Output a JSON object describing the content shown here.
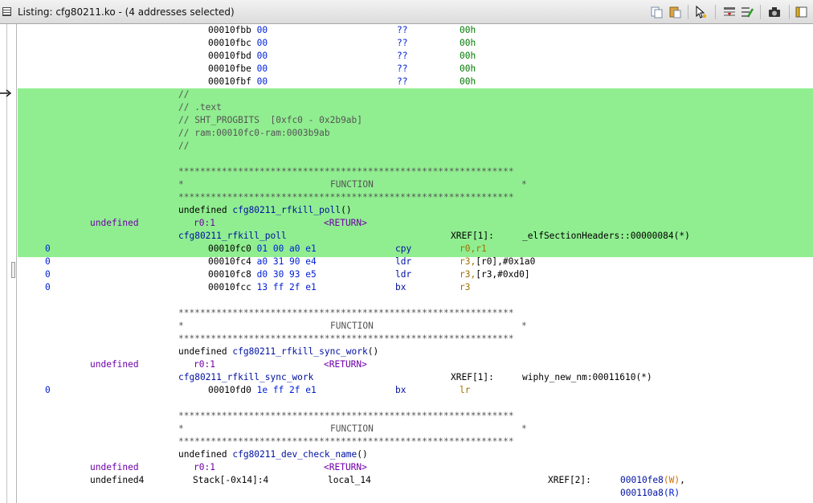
{
  "window": {
    "title": "Listing:  cfg80211.ko - (4 addresses selected)"
  },
  "toolbar": {
    "icons": [
      "copy-icon",
      "paste-icon",
      "cursor-select-icon",
      "field-layout-icon",
      "edit-fields-icon",
      "snapshot-icon",
      "window-menu-icon"
    ]
  },
  "colors": {
    "selection": "#90ee90",
    "bytes": "#0020d8",
    "comment": "#555555",
    "label": "#007a00",
    "function": "#0010a0",
    "register": "#a07000"
  },
  "data_rows": [
    {
      "addr": "00010fbb",
      "bytes": "00",
      "mnemonic": "??",
      "operand": "00h"
    },
    {
      "addr": "00010fbc",
      "bytes": "00",
      "mnemonic": "??",
      "operand": "00h"
    },
    {
      "addr": "00010fbd",
      "bytes": "00",
      "mnemonic": "??",
      "operand": "00h"
    },
    {
      "addr": "00010fbe",
      "bytes": "00",
      "mnemonic": "??",
      "operand": "00h"
    },
    {
      "addr": "00010fbf",
      "bytes": "00",
      "mnemonic": "??",
      "operand": "00h"
    }
  ],
  "section": {
    "c1": "//",
    "c2": "// .text",
    "c3": "// SHT_PROGBITS  [0xfc0 - 0x2b9ab]",
    "c4": "// ram:00010fc0-ram:0003b9ab",
    "c5": "//"
  },
  "banner": {
    "stars": "**************************************************************",
    "star": "*",
    "label": "FUNCTION"
  },
  "functions": [
    {
      "sig_prefix": "undefined ",
      "name": "cfg80211_rfkill_poll",
      "sig_suffix": "()",
      "ret_type": "undefined",
      "ret_reg": "r0:1",
      "ret_tag": "<RETURN>",
      "label": "cfg80211_rfkill_poll",
      "xref": "XREF[1]:",
      "xref_target": "_elfSectionHeaders::00000084(*)",
      "instructions": [
        {
          "depth": "0",
          "addr": "00010fc0",
          "bytes": "01 00 a0 e1",
          "mnemonic": "cpy",
          "operand_a": "r0,r1",
          "operand_b": ""
        },
        {
          "depth": "0",
          "addr": "00010fc4",
          "bytes": "a0 31 90 e4",
          "mnemonic": "ldr",
          "operand_a": "r3,",
          "operand_b": "[r0],#0x1a0"
        },
        {
          "depth": "0",
          "addr": "00010fc8",
          "bytes": "d0 30 93 e5",
          "mnemonic": "ldr",
          "operand_a": "r3,",
          "operand_b": "[r3,#0xd0]"
        },
        {
          "depth": "0",
          "addr": "00010fcc",
          "bytes": "13 ff 2f e1",
          "mnemonic": "bx",
          "operand_a": "r3",
          "operand_b": ""
        }
      ]
    },
    {
      "sig_prefix": "undefined ",
      "name": "cfg80211_rfkill_sync_work",
      "sig_suffix": "()",
      "ret_type": "undefined",
      "ret_reg": "r0:1",
      "ret_tag": "<RETURN>",
      "label": "cfg80211_rfkill_sync_work",
      "xref": "XREF[1]:",
      "xref_target": "wiphy_new_nm:00011610(*)",
      "instructions": [
        {
          "depth": "0",
          "addr": "00010fd0",
          "bytes": "1e ff 2f e1",
          "mnemonic": "bx",
          "operand_a": "lr",
          "operand_b": ""
        }
      ]
    },
    {
      "sig_prefix": "undefined ",
      "name": "cfg80211_dev_check_name",
      "sig_suffix": "()",
      "ret_type": "undefined",
      "ret_reg": "r0:1",
      "ret_tag": "<RETURN>",
      "param_type": "undefined4",
      "param_storage": "Stack[-0x14]:4",
      "param_name": "local_14",
      "xref": "XREF[2]:",
      "xref_1": "00010fe8",
      "xref_1_kind": "(W)",
      "xref_2": "000110a8",
      "xref_2_kind": "(R)"
    }
  ]
}
